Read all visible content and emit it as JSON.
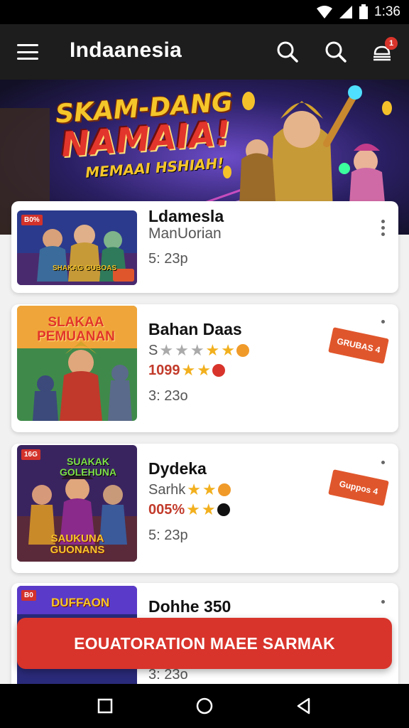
{
  "status_bar": {
    "time": "1:36"
  },
  "app_bar": {
    "title": "Indaanesia",
    "notification_count": "1"
  },
  "banner": {
    "line1": "SKAM-DANG",
    "line2": "NAMAIA!",
    "line3": "MEMAAI HSHIAH!"
  },
  "games": [
    {
      "title": "Ldamesla",
      "subtitle": "ManUorian",
      "size": "5: 23p",
      "thumb_tag": "B0%",
      "thumb_caption": "SHAKAG GUBOAS"
    },
    {
      "title": "Bahan Daas",
      "rating_text": "S",
      "price": "1099",
      "size": "3: 23o",
      "badge": "GRUBAS 4",
      "thumb_caption": "SLAKAA PEMUANAN"
    },
    {
      "title": "Dydeka",
      "rating_text": "Sarhk",
      "price": "005%",
      "size": "5: 23p",
      "badge": "Guppos 4",
      "thumb_tag": "16G",
      "thumb_caption": "SUAKAK GOLEHUNA",
      "thumb_caption2": "SAUKUNA GUONANS"
    },
    {
      "title": "Dohhe 350",
      "size": "3: 23o",
      "thumb_tag": "B0",
      "thumb_caption": "DUFFAON"
    }
  ],
  "cta": {
    "label": "EOUATORATION MAEE SARMAK"
  },
  "colors": {
    "accent": "#d8342b",
    "app_bar": "#1d1d1d",
    "star": "#f2b01e"
  }
}
